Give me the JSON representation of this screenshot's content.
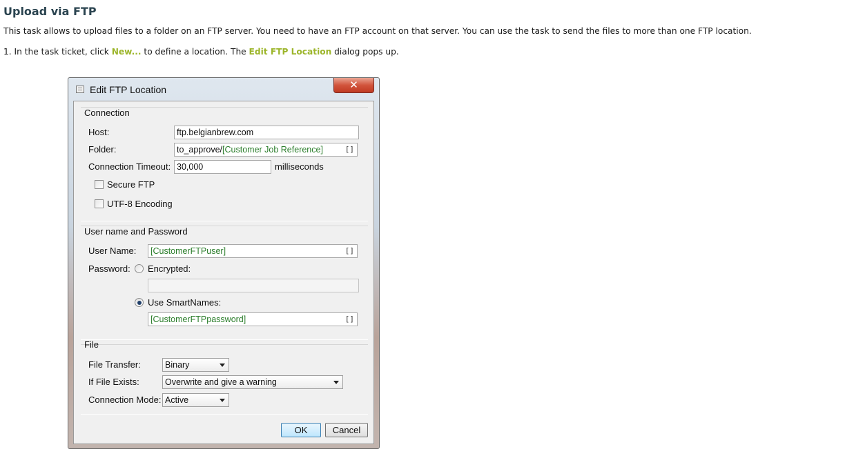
{
  "doc": {
    "heading": "Upload via FTP",
    "intro": "This task allows to upload files to a folder on an FTP server. You need to have an FTP account on that server. You can use the task to send the files to more than one FTP location.",
    "step_prefix": "1. In the task ticket, click ",
    "step_new": "New...",
    "step_mid": " to define a location. The ",
    "step_dialog": "Edit FTP Location",
    "step_suffix": " dialog pops up."
  },
  "dialog": {
    "title": "Edit FTP Location",
    "close_glyph": "✕",
    "connection": {
      "group_label": "Connection",
      "host_label": "Host:",
      "host_value": "ftp.belgianbrew.com",
      "folder_label": "Folder:",
      "folder_prefix": "to_approve/",
      "folder_smartname": "[Customer Job Reference]",
      "timeout_label": "Connection Timeout:",
      "timeout_value": "30,000",
      "timeout_unit": "milliseconds",
      "secure_ftp_label": "Secure FTP",
      "secure_ftp_checked": false,
      "utf8_label": "UTF-8 Encoding",
      "utf8_checked": false
    },
    "credentials": {
      "group_label": "User name and Password",
      "username_label": "User Name:",
      "username_value": "[CustomerFTPuser]",
      "password_label": "Password:",
      "encrypted_label": "Encrypted:",
      "encrypted_selected": false,
      "encrypted_value": "",
      "smartnames_label": "Use SmartNames:",
      "smartnames_selected": true,
      "smartnames_value": "[CustomerFTPpassword]"
    },
    "file": {
      "group_label": "File",
      "transfer_label": "File Transfer:",
      "transfer_value": "Binary",
      "exists_label": "If File Exists:",
      "exists_value": "Overwrite and give a warning",
      "mode_label": "Connection Mode:",
      "mode_value": "Active"
    },
    "smart_icon_glyph": "[]",
    "ok_label": "OK",
    "cancel_label": "Cancel"
  },
  "colors": {
    "heading": "#2b4450",
    "link_highlight": "#9cb52a",
    "smartname_text": "#2a7d2a",
    "close_button": "#c03a22"
  }
}
